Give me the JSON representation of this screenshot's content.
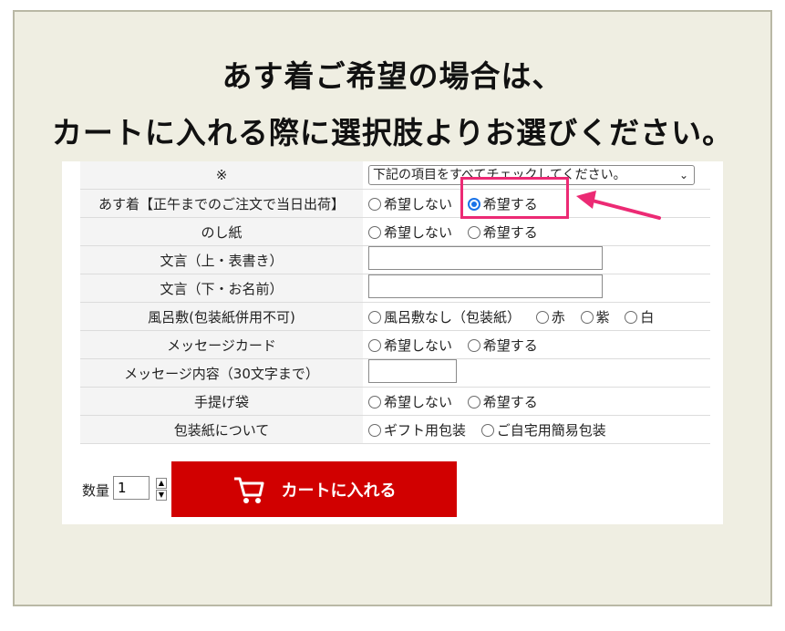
{
  "headline": {
    "line1": "あす着ご希望の場合は、",
    "line2": "カートに入れる際に選択肢よりお選びください。"
  },
  "rows": [
    {
      "label": "※",
      "type": "select",
      "value": "下記の項目をすべてチェックしてください。"
    },
    {
      "label": "あす着【正午までのご注文で当日出荷】",
      "type": "radio",
      "options": [
        {
          "text": "希望しない",
          "checked": false
        },
        {
          "text": "希望する",
          "checked": true
        }
      ]
    },
    {
      "label": "のし紙",
      "type": "radio",
      "options": [
        {
          "text": "希望しない",
          "checked": false
        },
        {
          "text": "希望する",
          "checked": false
        }
      ]
    },
    {
      "label": "文言（上・表書き）",
      "type": "text",
      "value": ""
    },
    {
      "label": "文言（下・お名前）",
      "type": "text",
      "value": ""
    },
    {
      "label": "風呂敷(包装紙併用不可)",
      "type": "radio",
      "options": [
        {
          "text": "風呂敷なし（包装紙）",
          "checked": false
        },
        {
          "text": "赤",
          "checked": false
        },
        {
          "text": "紫",
          "checked": false
        },
        {
          "text": "白",
          "checked": false
        }
      ]
    },
    {
      "label": "メッセージカード",
      "type": "radio",
      "options": [
        {
          "text": "希望しない",
          "checked": false
        },
        {
          "text": "希望する",
          "checked": false
        }
      ]
    },
    {
      "label": "メッセージ内容（30文字まで）",
      "type": "text",
      "value": ""
    },
    {
      "label": "手提げ袋",
      "type": "radio",
      "options": [
        {
          "text": "希望しない",
          "checked": false
        },
        {
          "text": "希望する",
          "checked": false
        }
      ]
    },
    {
      "label": "包装紙について",
      "type": "radio",
      "options": [
        {
          "text": "ギフト用包装",
          "checked": false
        },
        {
          "text": "ご自宅用簡易包装",
          "checked": false
        }
      ]
    }
  ],
  "quantity": {
    "label": "数量",
    "value": "1"
  },
  "cart_button": {
    "label": "カートに入れる",
    "icon": "cart-icon"
  },
  "colors": {
    "accent": "#d10000",
    "highlight": "#ec2a74",
    "radio_on": "#1a73e8"
  }
}
